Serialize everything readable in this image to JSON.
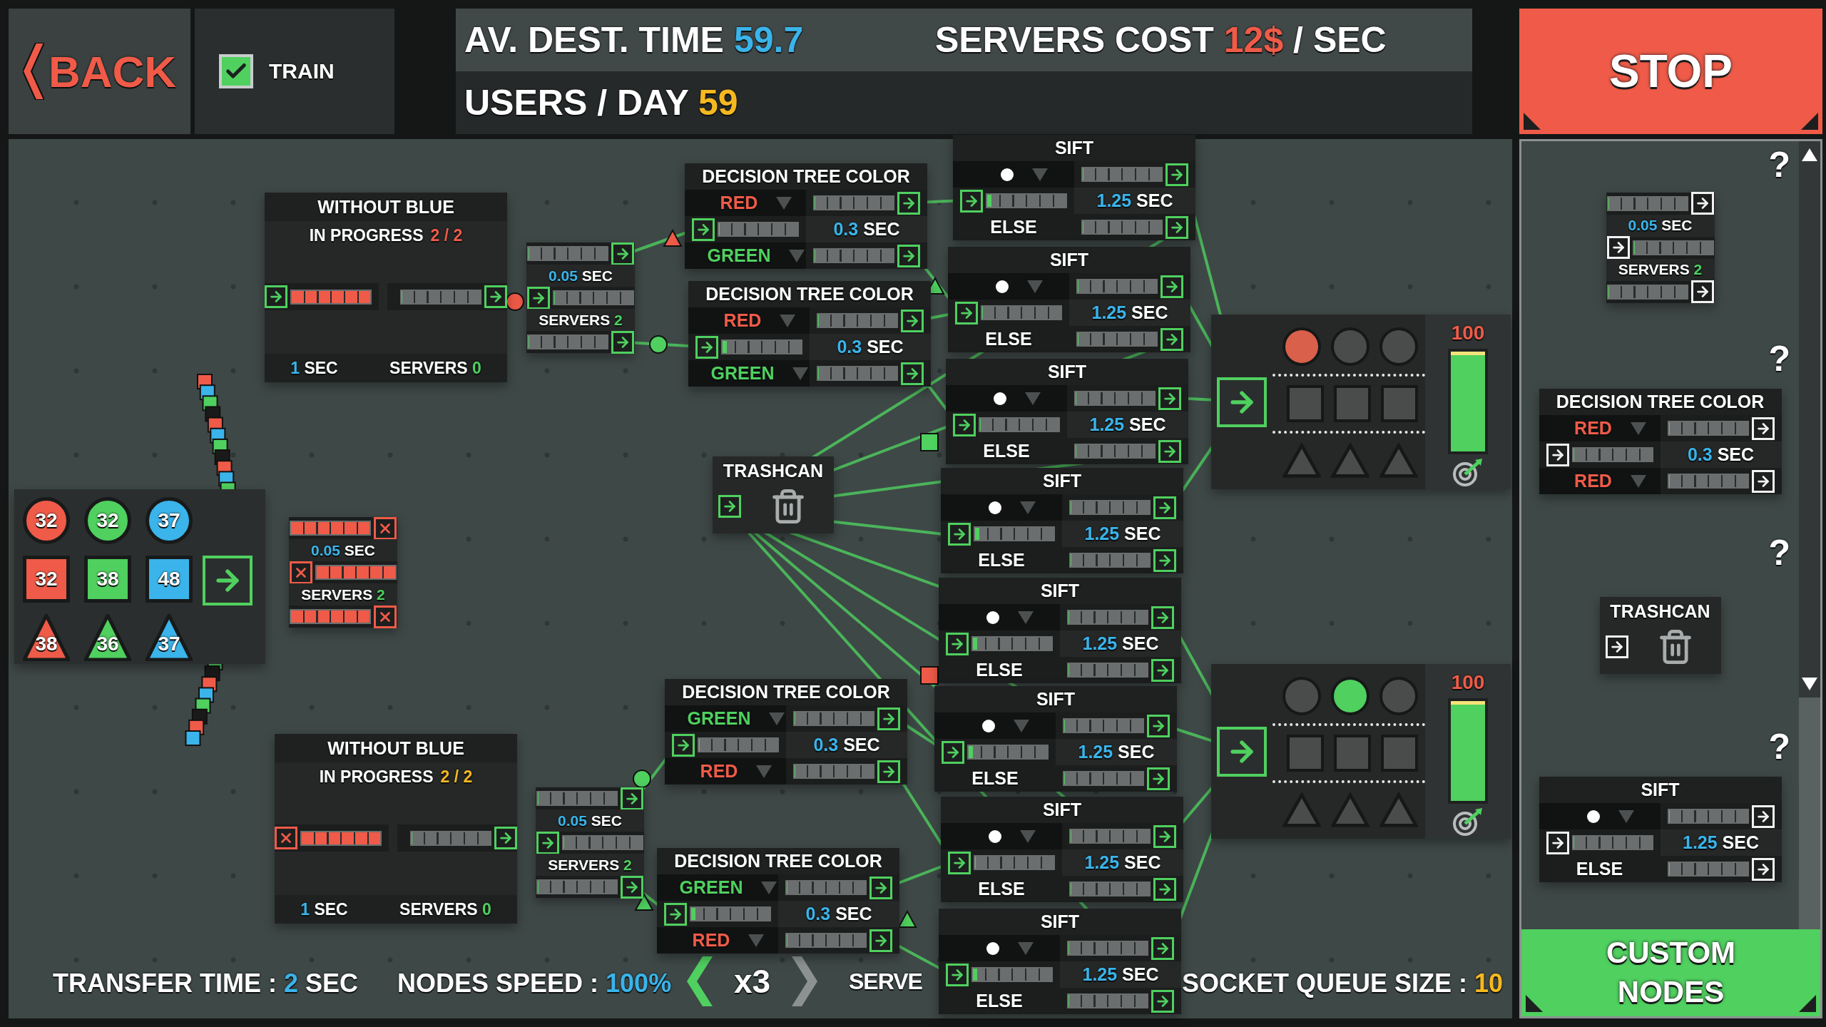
{
  "top_bar": {
    "back": {
      "label": "BACK"
    },
    "train": {
      "label": "TRAIN",
      "checked": true
    },
    "stats": [
      {
        "label": "AV. DEST. TIME",
        "value": "59.7",
        "color": "#3ab4ea"
      },
      {
        "label": "SERVERS COST",
        "value": "12$",
        "suffix": "/ SEC",
        "color": "#ef5b48"
      },
      {
        "label": "USERS / DAY",
        "value": "59",
        "color": "#f5b820"
      }
    ],
    "stop": {
      "label": "STOP"
    }
  },
  "canvas": {
    "nodes": [
      {
        "kind": "source",
        "tokens": [
          {
            "kind": "circle",
            "color": "#ef5b48",
            "count": "32"
          },
          {
            "kind": "circle",
            "color": "#4fd05f",
            "count": "32"
          },
          {
            "kind": "circle",
            "color": "#3ab4ea",
            "count": "37"
          },
          {
            "kind": "square",
            "color": "#ef5b48",
            "count": "32"
          },
          {
            "kind": "square",
            "color": "#4fd05f",
            "count": "38"
          },
          {
            "kind": "square",
            "color": "#3ab4ea",
            "count": "48"
          },
          {
            "kind": "triangle",
            "color": "#ef5b48",
            "count": "38"
          },
          {
            "kind": "triangle",
            "color": "#4fd05f",
            "count": "36"
          },
          {
            "kind": "triangle",
            "color": "#3ab4ea",
            "count": "37"
          }
        ]
      },
      {
        "kind": "process",
        "title": "WITHOUT BLUE",
        "progress": {
          "label": "IN PROGRESS",
          "value": "2 / 2",
          "color": "#ef5b48"
        },
        "in": {
          "level": 1,
          "blocked": false
        },
        "out": {
          "level": 0,
          "blocked": false
        },
        "time": "1",
        "unit": "SEC",
        "servers_label": "SERVERS",
        "servers": "0"
      },
      {
        "kind": "server",
        "queues": [
          {
            "level": 0,
            "blocked": false
          },
          {
            "level": 0,
            "blocked": false
          },
          {
            "level": 0,
            "blocked": false
          }
        ],
        "time": "0.05",
        "unit": "SEC",
        "servers_label": "SERVERS",
        "servers": "2"
      },
      {
        "kind": "decision",
        "title": "DECISION TREE COLOR",
        "options": [
          {
            "label": "RED",
            "color": "#ef5b48"
          },
          {
            "label": "GREEN",
            "color": "#4fd05f"
          }
        ],
        "queues": [
          {
            "level": 0,
            "blocked": false
          },
          {
            "level": 0,
            "blocked": false
          },
          {
            "level": 0,
            "blocked": false
          }
        ],
        "time": "0.3",
        "unit": "SEC"
      },
      {
        "kind": "decision",
        "title": "DECISION TREE COLOR",
        "options": [
          {
            "label": "RED",
            "color": "#ef5b48"
          },
          {
            "label": "GREEN",
            "color": "#4fd05f"
          }
        ],
        "queues": [
          {
            "level": 0,
            "blocked": false
          },
          {
            "level": 0.05,
            "blocked": false
          },
          {
            "level": 0,
            "blocked": false
          }
        ],
        "time": "0.3",
        "unit": "SEC"
      },
      {
        "kind": "trashcan",
        "title": "TRASHCAN"
      },
      {
        "kind": "server",
        "queues": [
          {
            "level": 1,
            "blocked": true
          },
          {
            "level": 1,
            "blocked": true
          },
          {
            "level": 1,
            "blocked": true
          }
        ],
        "time": "0.05",
        "unit": "SEC",
        "servers_label": "SERVERS",
        "servers": "2"
      },
      {
        "kind": "process",
        "title": "WITHOUT BLUE",
        "progress": {
          "label": "IN PROGRESS",
          "value": "2 / 2",
          "color": "#f5b820"
        },
        "in": {
          "level": 1,
          "blocked": true
        },
        "out": {
          "level": 0,
          "blocked": false
        },
        "time": "1",
        "unit": "SEC",
        "servers_label": "SERVERS",
        "servers": "0"
      },
      {
        "kind": "server",
        "queues": [
          {
            "level": 0,
            "blocked": false
          },
          {
            "level": 0,
            "blocked": false
          },
          {
            "level": 0,
            "blocked": false
          }
        ],
        "time": "0.05",
        "unit": "SEC",
        "servers_label": "SERVERS",
        "servers": "2"
      },
      {
        "kind": "decision",
        "title": "DECISION TREE COLOR",
        "options": [
          {
            "label": "GREEN",
            "color": "#4fd05f"
          },
          {
            "label": "RED",
            "color": "#ef5b48"
          }
        ],
        "queues": [
          {
            "level": 0,
            "blocked": false
          },
          {
            "level": 0,
            "blocked": false
          },
          {
            "level": 0,
            "blocked": false
          }
        ],
        "time": "0.3",
        "unit": "SEC"
      },
      {
        "kind": "decision",
        "title": "DECISION TREE COLOR",
        "options": [
          {
            "label": "GREEN",
            "color": "#4fd05f"
          },
          {
            "label": "RED",
            "color": "#ef5b48"
          }
        ],
        "queues": [
          {
            "level": 0,
            "blocked": false
          },
          {
            "level": 0.05,
            "blocked": false
          },
          {
            "level": 0,
            "blocked": false
          }
        ],
        "time": "0.3",
        "unit": "SEC"
      },
      {
        "kind": "sift",
        "title": "SIFT",
        "filter": {
          "kind": "circle"
        },
        "queues": [
          {
            "level": 0,
            "blocked": false
          },
          {
            "level": 0.05,
            "blocked": false
          },
          {
            "level": 0,
            "blocked": false
          }
        ],
        "time": "1.25",
        "unit": "SEC",
        "else_label": "ELSE"
      },
      {
        "kind": "sift",
        "title": "SIFT",
        "filter": {
          "kind": "circle"
        },
        "queues": [
          {
            "level": 0,
            "blocked": false
          },
          {
            "level": 0,
            "blocked": false
          },
          {
            "level": 0,
            "blocked": false
          }
        ],
        "time": "1.25",
        "unit": "SEC",
        "else_label": "ELSE"
      },
      {
        "kind": "sift",
        "title": "SIFT",
        "filter": {
          "kind": "circle"
        },
        "queues": [
          {
            "level": 0,
            "blocked": false
          },
          {
            "level": 0,
            "blocked": false
          },
          {
            "level": 0,
            "blocked": false
          }
        ],
        "time": "1.25",
        "unit": "SEC",
        "else_label": "ELSE"
      },
      {
        "kind": "sift",
        "title": "SIFT",
        "filter": {
          "kind": "circle"
        },
        "queues": [
          {
            "level": 0,
            "blocked": false
          },
          {
            "level": 0.05,
            "blocked": false
          },
          {
            "level": 0,
            "blocked": false
          }
        ],
        "time": "1.25",
        "unit": "SEC",
        "else_label": "ELSE"
      },
      {
        "kind": "sift",
        "title": "SIFT",
        "filter": {
          "kind": "circle"
        },
        "queues": [
          {
            "level": 0,
            "blocked": false
          },
          {
            "level": 0.05,
            "blocked": false
          },
          {
            "level": 0,
            "blocked": false
          }
        ],
        "time": "1.25",
        "unit": "SEC",
        "else_label": "ELSE"
      },
      {
        "kind": "sift",
        "title": "SIFT",
        "filter": {
          "kind": "circle"
        },
        "queues": [
          {
            "level": 0,
            "blocked": false
          },
          {
            "level": 0.05,
            "blocked": false
          },
          {
            "level": 0,
            "blocked": false
          }
        ],
        "time": "1.25",
        "unit": "SEC",
        "else_label": "ELSE"
      },
      {
        "kind": "sift",
        "title": "SIFT",
        "filter": {
          "kind": "circle"
        },
        "queues": [
          {
            "level": 0,
            "blocked": false
          },
          {
            "level": 0,
            "blocked": false
          },
          {
            "level": 0,
            "blocked": false
          }
        ],
        "time": "1.25",
        "unit": "SEC",
        "else_label": "ELSE"
      },
      {
        "kind": "sift",
        "title": "SIFT",
        "filter": {
          "kind": "circle"
        },
        "queues": [
          {
            "level": 0,
            "blocked": false
          },
          {
            "level": 0.05,
            "blocked": false
          },
          {
            "level": 0,
            "blocked": false
          }
        ],
        "time": "1.25",
        "unit": "SEC",
        "else_label": "ELSE"
      },
      {
        "kind": "destination",
        "targets": [
          {
            "kind": "circle",
            "color": "#d9604a"
          },
          {
            "kind": "circle",
            "color": "#4a4c4c"
          },
          {
            "kind": "circle",
            "color": "#4a4c4c"
          },
          {
            "kind": "square",
            "color": "#4a4c4c"
          },
          {
            "kind": "square",
            "color": "#4a4c4c"
          },
          {
            "kind": "square",
            "color": "#4a4c4c"
          },
          {
            "kind": "triangle",
            "color": "#4a4c4c"
          },
          {
            "kind": "triangle",
            "color": "#4a4c4c"
          },
          {
            "kind": "triangle",
            "color": "#4a4c4c"
          }
        ],
        "meter": {
          "reading": "100",
          "level": 1
        }
      },
      {
        "kind": "destination",
        "targets": [
          {
            "kind": "circle",
            "color": "#4a4c4c"
          },
          {
            "kind": "circle",
            "color": "#4fd05f"
          },
          {
            "kind": "circle",
            "color": "#4a4c4c"
          },
          {
            "kind": "square",
            "color": "#4a4c4c"
          },
          {
            "kind": "square",
            "color": "#4a4c4c"
          },
          {
            "kind": "square",
            "color": "#4a4c4c"
          },
          {
            "kind": "triangle",
            "color": "#4a4c4c"
          },
          {
            "kind": "triangle",
            "color": "#4a4c4c"
          },
          {
            "kind": "triangle",
            "color": "#4a4c4c"
          }
        ],
        "meter": {
          "reading": "100",
          "level": 1
        }
      }
    ],
    "footer": {
      "stats": [
        {
          "label": "TRANSFER TIME :",
          "value": "2",
          "suffix": "SEC",
          "color": "#3ab4ea"
        },
        {
          "label": "NODES SPEED :",
          "value": "100%",
          "color": "#3ab4ea"
        },
        {
          "label": "SOCKET QUEUE SIZE :",
          "value": "10",
          "color": "#f5b820"
        }
      ],
      "speed": {
        "prev_disabled": false,
        "value": "x3",
        "next_disabled": true
      },
      "cut_label": "SERVE"
    }
  },
  "sidebar": {
    "items": [
      {
        "kind": "server",
        "help": "?",
        "queues": [
          {
            "level": 0,
            "blocked": false
          },
          {
            "level": 0,
            "blocked": false
          },
          {
            "level": 0,
            "blocked": false
          }
        ],
        "time": "0.05",
        "unit": "SEC",
        "servers_label": "SERVERS",
        "servers": "2"
      },
      {
        "kind": "decision",
        "help": "?",
        "title": "DECISION TREE COLOR",
        "options": [
          {
            "label": "RED",
            "color": "#ef5b48"
          },
          {
            "label": "RED",
            "color": "#ef5b48"
          }
        ],
        "queues": [
          {
            "level": 0,
            "blocked": false
          },
          {
            "level": 0,
            "blocked": false
          },
          {
            "level": 0,
            "blocked": false
          }
        ],
        "time": "0.3",
        "unit": "SEC"
      },
      {
        "kind": "trashcan",
        "help": "?",
        "title": "TRASHCAN"
      },
      {
        "kind": "sift",
        "help": "?",
        "title": "SIFT",
        "filter": {
          "kind": "circle"
        },
        "queues": [
          {
            "level": 0,
            "blocked": false
          },
          {
            "level": 0,
            "blocked": false
          },
          {
            "level": 0,
            "blocked": false
          }
        ],
        "time": "1.25",
        "unit": "SEC",
        "else_label": "ELSE"
      }
    ],
    "custom_nodes": {
      "label": "CUSTOM NODES"
    }
  }
}
